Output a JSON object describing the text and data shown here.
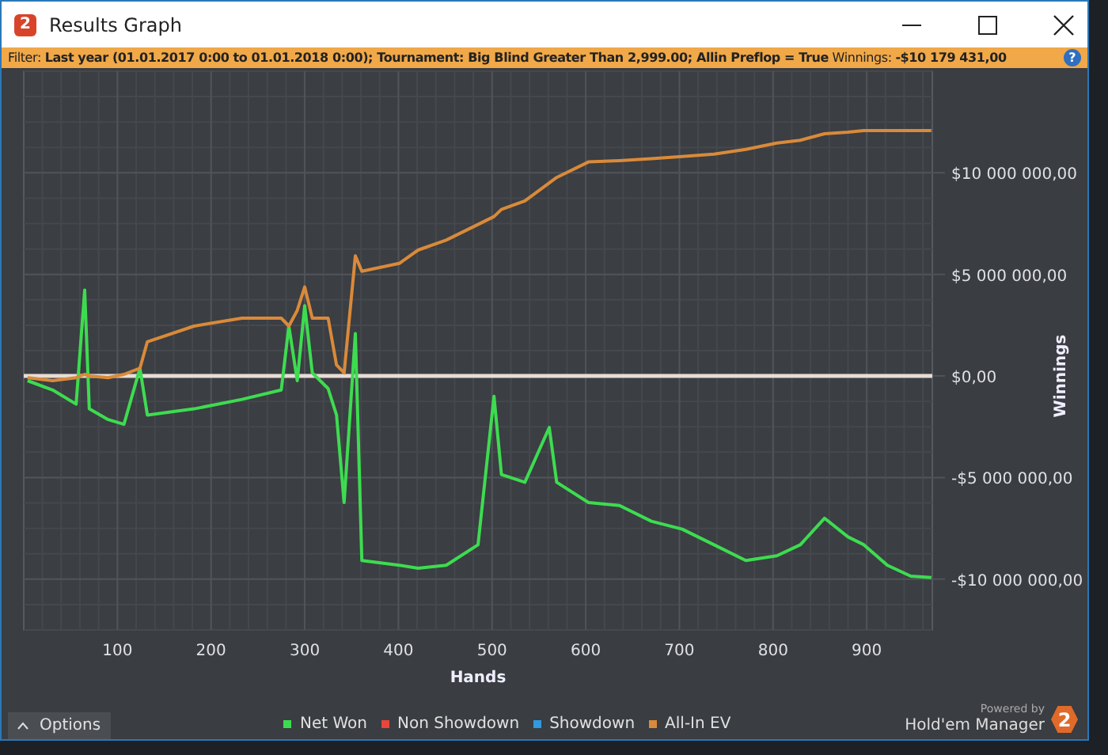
{
  "window": {
    "icon_text": "2",
    "title": "Results Graph"
  },
  "filter_bar": {
    "text": "Filter: **Last year (01.01.2017 0:00 to 01.01.2018 0:00); Tournament: Big Blind Greater Than 2,999.00; Allin Preflop = True** Winnings: **-$10 179 431,00**",
    "help": "?"
  },
  "chart": {
    "chart_data": {
      "type": "line",
      "xlabel": "Hands",
      "ylabel": "Winnings",
      "grid": true,
      "xlim": [
        0,
        970
      ],
      "ylim": [
        -12500000,
        15000000
      ],
      "xticks": [
        100,
        200,
        300,
        400,
        500,
        600,
        700,
        800,
        900
      ],
      "yticks": [
        {
          "value": 10000000,
          "label": "$10 000 000,00"
        },
        {
          "value": 5000000,
          "label": "$5 000 000,00"
        },
        {
          "value": 0,
          "label": "$0,00"
        },
        {
          "value": -5000000,
          "label": "-$5 000 000,00"
        },
        {
          "value": -10000000,
          "label": "-$10 000 000,00"
        }
      ],
      "x": [
        4,
        31,
        56,
        65,
        70,
        90,
        107,
        124,
        132,
        182,
        233,
        275,
        283,
        292,
        300,
        308,
        325,
        334,
        342,
        354,
        361,
        401,
        421,
        451,
        485,
        502,
        510,
        535,
        561,
        569,
        603,
        636,
        670,
        703,
        737,
        771,
        804,
        829,
        855,
        880,
        897,
        922,
        947,
        969
      ],
      "series": [
        {
          "name": "Net Won",
          "color": "#3ddc50",
          "values": [
            -230000,
            -690000,
            -1380000,
            4230000,
            -1620000,
            -2150000,
            -2380000,
            380000,
            -1920000,
            -1620000,
            -1150000,
            -690000,
            2460000,
            -230000,
            3460000,
            150000,
            -620000,
            -1920000,
            -6230000,
            2080000,
            -9080000,
            -9310000,
            -9460000,
            -9310000,
            -8310000,
            -1000000,
            -4850000,
            -5230000,
            -2540000,
            -5230000,
            -6230000,
            -6380000,
            -7150000,
            -7540000,
            -8310000,
            -9080000,
            -8850000,
            -8310000,
            -7000000,
            -7920000,
            -8310000,
            -9310000,
            -9850000,
            -9920000
          ]
        },
        {
          "name": "Non Showdown",
          "color": "#e8453c",
          "values": [
            null,
            null,
            null,
            null,
            null,
            null,
            null,
            null,
            null,
            null,
            null,
            null,
            null,
            null,
            null,
            null,
            null,
            null,
            null,
            null,
            null,
            null,
            null,
            null,
            null,
            null,
            null,
            null,
            null,
            null,
            null,
            null,
            null,
            null,
            null,
            null,
            null,
            null,
            null,
            null,
            null,
            null,
            null,
            null
          ]
        },
        {
          "name": "Showdown",
          "color": "#2f9ae0",
          "values": [
            null,
            null,
            null,
            null,
            null,
            null,
            null,
            null,
            null,
            null,
            null,
            null,
            null,
            null,
            null,
            null,
            null,
            null,
            null,
            null,
            null,
            null,
            null,
            null,
            null,
            null,
            null,
            null,
            null,
            null,
            null,
            null,
            null,
            null,
            null,
            null,
            null,
            null,
            null,
            null,
            null,
            null,
            null,
            null
          ]
        },
        {
          "name": "All-In EV",
          "color": "#d98a3a",
          "values": [
            -80000,
            -230000,
            -80000,
            80000,
            0,
            -80000,
            80000,
            380000,
            1690000,
            2460000,
            2850000,
            2850000,
            2460000,
            3230000,
            4380000,
            2850000,
            2850000,
            540000,
            150000,
            5920000,
            5150000,
            5540000,
            6200000,
            6690000,
            7460000,
            7850000,
            8200000,
            8620000,
            9500000,
            9770000,
            10540000,
            10600000,
            10690000,
            10800000,
            10920000,
            11150000,
            11460000,
            11600000,
            11920000,
            12000000,
            12080000,
            12080000,
            12080000,
            12080000
          ]
        }
      ]
    }
  },
  "footer": {
    "options_button": "Options",
    "powered_by": "Powered by",
    "brand": "Hold'em Manager",
    "brand_badge": "2"
  }
}
